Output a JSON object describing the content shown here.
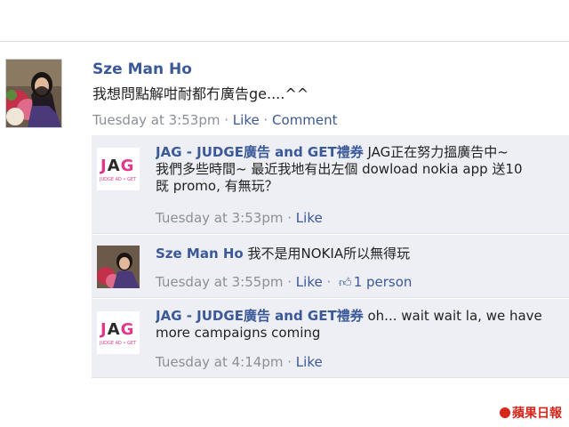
{
  "post": {
    "author": "Sze Man Ho",
    "text": "我想問點解咁耐都冇廣告ge....^^",
    "time": "Tuesday at 3:53pm",
    "sep": "·",
    "like": "Like",
    "comment": "Comment"
  },
  "comments": [
    {
      "author": "JAG - JUDGE廣告 and GET禮券",
      "line1": "JAG正在努力搵廣告中~",
      "line2": "我們多些時間~ 最近我地有出左個 dowload nokia app 送10",
      "line3": "既 promo, 有無玩？",
      "time": "Tuesday at 3:53pm",
      "like": "Like"
    },
    {
      "author": "Sze Man Ho",
      "line1": "我不是用NOKIA所以無得玩",
      "time": "Tuesday at 3:55pm",
      "like": "Like",
      "likes_count": "1 person"
    },
    {
      "author": "JAG - JUDGE廣告 and GET禮券",
      "line1": "oh... wait wait la, we have",
      "line2": "more campaigns coming",
      "time": "Tuesday at 4:14pm",
      "like": "Like"
    }
  ],
  "jag_logo": {
    "j": "J",
    "a": "A",
    "g": "G",
    "sub": "JUDGE AD • GET"
  },
  "watermark": "蘋果日報",
  "icons": {
    "like_thumb": "thumbs-up-icon",
    "brand_apple": "apple-daily-logo-icon"
  },
  "colors": {
    "link": "#3b5998",
    "comment_bg": "#edeff4",
    "brand_pink": "#e0388a",
    "watermark_red": "#d8261c"
  }
}
